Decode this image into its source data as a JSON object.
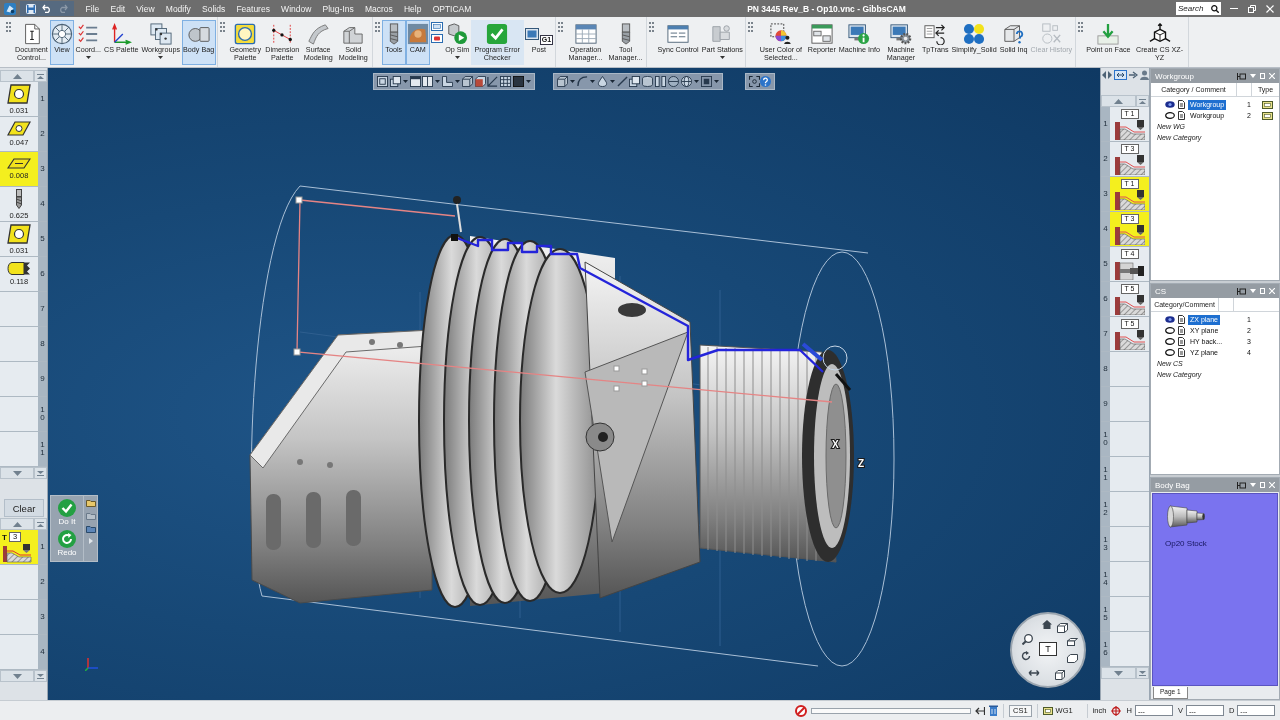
{
  "window": {
    "title": "PN 3445 Rev_B - Op10.vnc - GibbsCAM",
    "search": {
      "placeholder": "Search"
    }
  },
  "menu": [
    "File",
    "Edit",
    "View",
    "Modify",
    "Solids",
    "Features",
    "Window",
    "Plug-Ins",
    "Macros",
    "Help",
    "OPTICAM"
  ],
  "toolbar": [
    [
      {
        "kind": "button",
        "label": "Document Control...",
        "selected": false,
        "hovered": false,
        "disabled": false,
        "dropdown": false
      },
      {
        "kind": "button",
        "label": "View",
        "selected": true,
        "hovered": false,
        "disabled": false,
        "dropdown": false
      },
      {
        "kind": "button",
        "label": "Coord...",
        "selected": false,
        "hovered": false,
        "disabled": false,
        "dropdown": true
      },
      {
        "kind": "button",
        "label": "CS Palette",
        "selected": false,
        "hovered": false,
        "disabled": false,
        "dropdown": false
      },
      {
        "kind": "button",
        "label": "Workgroups",
        "selected": false,
        "hovered": false,
        "disabled": false,
        "dropdown": true
      },
      {
        "kind": "button",
        "label": "Body Bag",
        "selected": true,
        "hovered": false,
        "disabled": false,
        "dropdown": false
      }
    ],
    [
      {
        "kind": "button",
        "label": "Geometry Palette",
        "selected": false,
        "hovered": false,
        "disabled": false,
        "dropdown": false
      },
      {
        "kind": "button",
        "label": "Dimension Palette",
        "selected": false,
        "hovered": false,
        "disabled": false,
        "dropdown": false
      },
      {
        "kind": "button",
        "label": "Surface Modeling",
        "selected": false,
        "hovered": false,
        "disabled": false,
        "dropdown": false
      },
      {
        "kind": "button",
        "label": "Solid Modeling",
        "selected": false,
        "hovered": false,
        "disabled": false,
        "dropdown": false
      }
    ],
    [
      {
        "kind": "button",
        "label": "Tools",
        "selected": true,
        "hovered": false,
        "disabled": false,
        "dropdown": false
      },
      {
        "kind": "button",
        "label": "CAM",
        "selected": true,
        "hovered": false,
        "disabled": false,
        "dropdown": false
      },
      {
        "kind": "pair"
      },
      {
        "kind": "button",
        "label": "Op Sim",
        "selected": false,
        "hovered": false,
        "disabled": false,
        "dropdown": true
      },
      {
        "kind": "button",
        "label": "Program Error Checker",
        "selected": false,
        "hovered": true,
        "disabled": false,
        "dropdown": false
      },
      {
        "kind": "button",
        "label": "Post",
        "tag": "G1",
        "selected": false,
        "hovered": false,
        "disabled": false,
        "dropdown": false
      }
    ],
    [
      {
        "kind": "button",
        "label": "Operation Manager...",
        "selected": false,
        "hovered": false,
        "disabled": false,
        "dropdown": false
      },
      {
        "kind": "button",
        "label": "Tool Manager...",
        "selected": false,
        "hovered": false,
        "disabled": false,
        "dropdown": false
      }
    ],
    [
      {
        "kind": "button",
        "label": "Sync Control",
        "selected": false,
        "hovered": false,
        "disabled": false,
        "dropdown": false
      },
      {
        "kind": "button",
        "label": "Part Stations",
        "selected": false,
        "hovered": false,
        "disabled": false,
        "dropdown": true
      }
    ],
    [
      {
        "kind": "button",
        "label": "User Color of Selected...",
        "selected": false,
        "hovered": false,
        "disabled": false,
        "dropdown": false
      },
      {
        "kind": "button",
        "label": "Reporter",
        "selected": false,
        "hovered": false,
        "disabled": false,
        "dropdown": false
      },
      {
        "kind": "button",
        "label": "Machine Info",
        "selected": false,
        "hovered": false,
        "disabled": false,
        "dropdown": false
      },
      {
        "kind": "button",
        "label": "Machine Manager",
        "selected": false,
        "hovered": false,
        "disabled": false,
        "dropdown": false
      },
      {
        "kind": "button",
        "label": "TpTrans",
        "selected": false,
        "hovered": false,
        "disabled": false,
        "dropdown": false
      },
      {
        "kind": "button",
        "label": "Simplify_Solid",
        "selected": false,
        "hovered": false,
        "disabled": false,
        "dropdown": false
      },
      {
        "kind": "button",
        "label": "Solid Inq",
        "selected": false,
        "hovered": false,
        "disabled": false,
        "dropdown": false
      },
      {
        "kind": "button",
        "label": "Clear History",
        "selected": false,
        "hovered": false,
        "disabled": true,
        "dropdown": false
      }
    ],
    [
      {
        "kind": "button",
        "label": "Point on Face",
        "selected": false,
        "hovered": false,
        "disabled": false,
        "dropdown": false
      },
      {
        "kind": "button",
        "label": "Create CS XZ-YZ",
        "selected": false,
        "hovered": false,
        "disabled": false,
        "dropdown": false
      }
    ]
  ],
  "tool_list": {
    "tools": [
      {
        "number": "1",
        "value": "0.031",
        "kind": "diamond",
        "selected": false
      },
      {
        "number": "2",
        "value": "0.047",
        "kind": "rhombus",
        "selected": false
      },
      {
        "number": "3",
        "value": "0.008",
        "kind": "flat",
        "selected": true
      },
      {
        "number": "4",
        "value": "0.625",
        "kind": "drill",
        "selected": false
      },
      {
        "number": "5",
        "value": "0.031",
        "kind": "diamond",
        "selected": false
      },
      {
        "number": "6",
        "value": "0.118",
        "kind": "groove",
        "selected": false
      },
      {
        "number": "7",
        "kind": "empty",
        "selected": false
      },
      {
        "number": "8",
        "kind": "empty",
        "selected": false
      },
      {
        "number": "9",
        "kind": "empty",
        "selected": false
      },
      {
        "number": "10",
        "kind": "empty",
        "selected": false
      },
      {
        "number": "11",
        "kind": "empty",
        "selected": false
      }
    ]
  },
  "clear_button": {
    "label": "Clear"
  },
  "process_list": {
    "processes": [
      {
        "number": "1",
        "tool_letter": "T",
        "tool_number": "3",
        "kind": "turning",
        "selected": true
      },
      {
        "number": "2",
        "kind": "empty",
        "selected": false
      },
      {
        "number": "3",
        "kind": "empty",
        "selected": false
      },
      {
        "number": "4",
        "kind": "empty",
        "selected": false
      }
    ]
  },
  "viewport": {
    "axis_labels": [
      "X",
      "Z"
    ],
    "action_palette": [
      {
        "label": "Do It",
        "kind": "check"
      },
      {
        "label": "Redo",
        "kind": "redo"
      }
    ],
    "navigation_wheel": {
      "center_label": "T"
    }
  },
  "operations": [
    {
      "number": "1",
      "tool": "T 1",
      "kind": "turning",
      "selected": false
    },
    {
      "number": "2",
      "tool": "T 3",
      "kind": "turning",
      "selected": false
    },
    {
      "number": "3",
      "tool": "T 1",
      "kind": "turning",
      "selected": true
    },
    {
      "number": "4",
      "tool": "T 3",
      "kind": "turning",
      "selected": true
    },
    {
      "number": "5",
      "tool": "T 4",
      "kind": "drilling",
      "selected": false
    },
    {
      "number": "6",
      "tool": "T 5",
      "kind": "turning",
      "selected": false
    },
    {
      "number": "7",
      "tool": "T 5",
      "kind": "turning",
      "selected": false
    },
    {
      "number": "8",
      "kind": "empty",
      "selected": false
    },
    {
      "number": "9",
      "kind": "empty",
      "selected": false
    },
    {
      "number": "10",
      "kind": "empty",
      "selected": false
    },
    {
      "number": "11",
      "kind": "empty",
      "selected": false
    },
    {
      "number": "12",
      "kind": "empty",
      "selected": false
    },
    {
      "number": "13",
      "kind": "empty",
      "selected": false
    },
    {
      "number": "14",
      "kind": "empty",
      "selected": false
    },
    {
      "number": "15",
      "kind": "empty",
      "selected": false
    },
    {
      "number": "16",
      "kind": "empty",
      "selected": false
    }
  ],
  "workgroup_panel": {
    "title": "Workgroup",
    "columns": [
      "Category / Comment",
      "Type"
    ],
    "rows": [
      {
        "name": "Workgroup",
        "number": "1",
        "current": true,
        "selected": true
      },
      {
        "name": "Workgroup",
        "number": "2",
        "current": false,
        "selected": false
      }
    ],
    "new_items": [
      "New WG",
      "New Category"
    ]
  },
  "cs_panel": {
    "title": "CS",
    "columns": [
      "Category/Comment"
    ],
    "rows": [
      {
        "name": "ZX plane",
        "number": "1",
        "current": true,
        "selected": true
      },
      {
        "name": "XY plane",
        "number": "2",
        "current": false,
        "selected": false
      },
      {
        "name": "HY back...",
        "number": "3",
        "current": false,
        "selected": false
      },
      {
        "name": "YZ plane",
        "number": "4",
        "current": false,
        "selected": false
      }
    ],
    "new_items": [
      "New CS",
      "New Category"
    ]
  },
  "body_bag_panel": {
    "title": "Body Bag",
    "items": [
      {
        "label": "Op20 Stock"
      }
    ],
    "tabs": [
      {
        "label": "Page 1",
        "selected": true
      }
    ]
  },
  "status_bar": {
    "cs": "CS1",
    "workgroup": "WG1",
    "units": "inch",
    "fields": [
      {
        "label": "H",
        "value": "---"
      },
      {
        "label": "V",
        "value": "---"
      },
      {
        "label": "D",
        "value": "---"
      }
    ]
  }
}
